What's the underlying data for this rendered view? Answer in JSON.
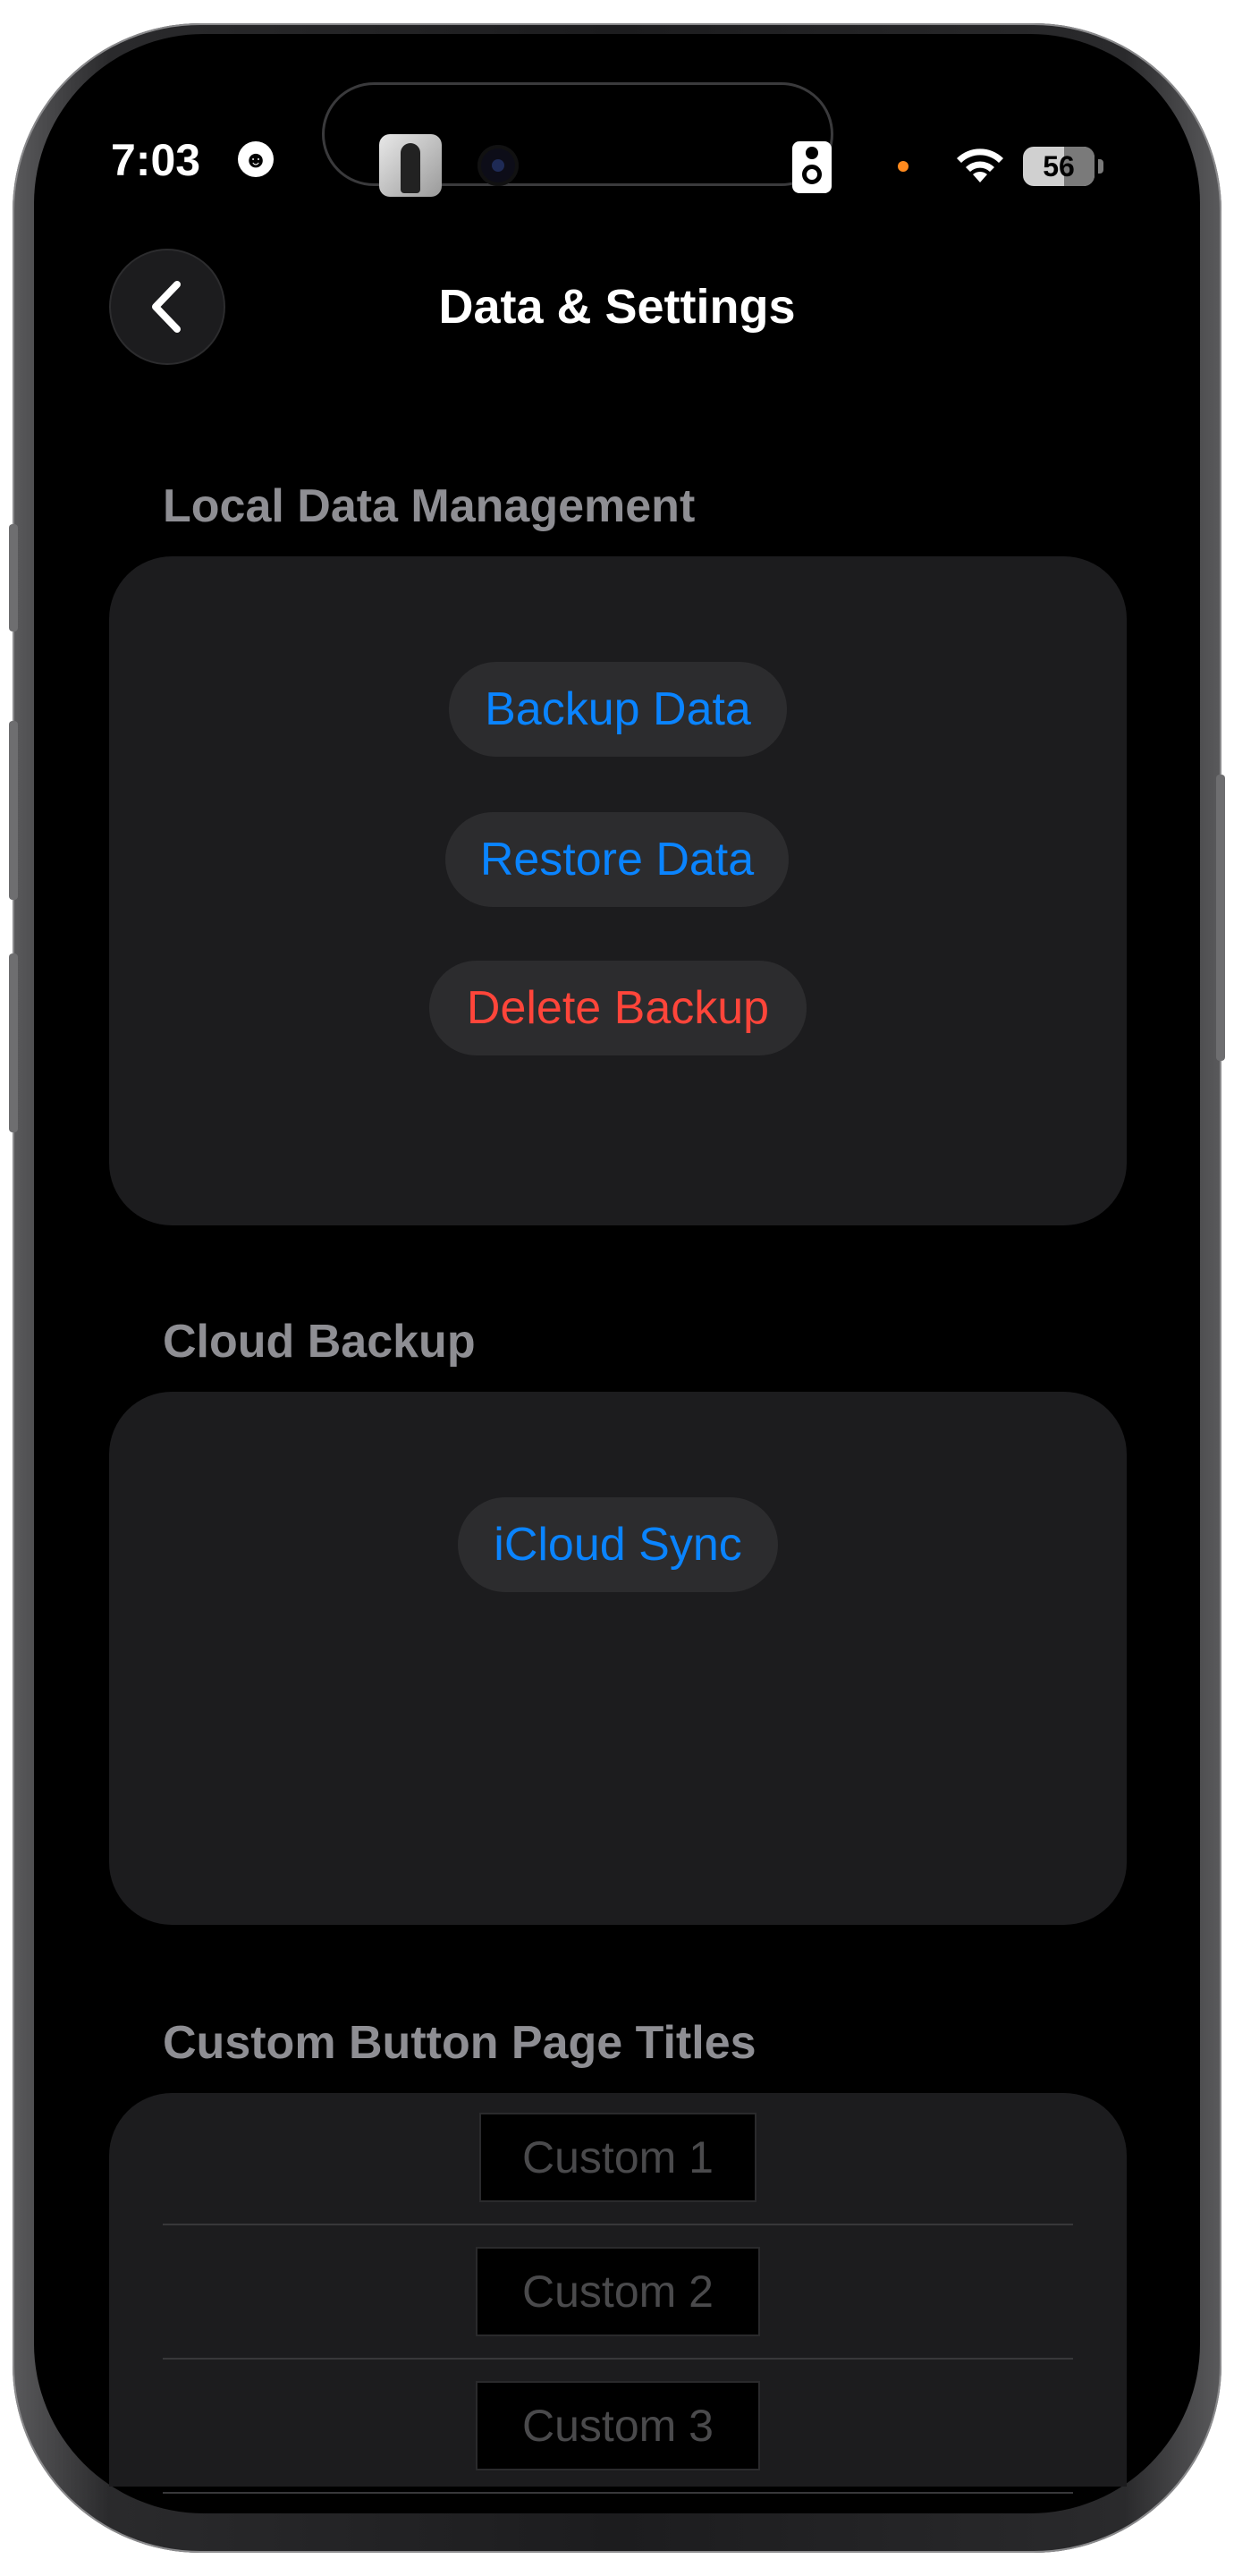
{
  "status_bar": {
    "time": "7:03",
    "battery": "56",
    "icons": [
      "smiley-icon",
      "album-art-icon",
      "camera-icon",
      "speaker-icon",
      "privacy-dot-icon",
      "wifi-icon",
      "battery-icon"
    ]
  },
  "nav": {
    "title": "Data & Settings",
    "back_icon": "chevron-left-icon"
  },
  "local_data": {
    "header": "Local Data Management",
    "backup_label": "Backup Data",
    "restore_label": "Restore Data",
    "delete_label": "Delete Backup"
  },
  "cloud_backup": {
    "header": "Cloud Backup",
    "icloud_label": "iCloud Sync"
  },
  "custom_titles": {
    "header": "Custom Button Page Titles",
    "fields": [
      {
        "placeholder": "Custom 1"
      },
      {
        "placeholder": "Custom 2"
      },
      {
        "placeholder": "Custom 3"
      }
    ]
  },
  "colors": {
    "background": "#000000",
    "card": "#1c1c1e",
    "pill": "#2c2c2e",
    "accent_blue": "#0a84ff",
    "destructive_red": "#ff453a",
    "section_header": "#8e8e93"
  }
}
